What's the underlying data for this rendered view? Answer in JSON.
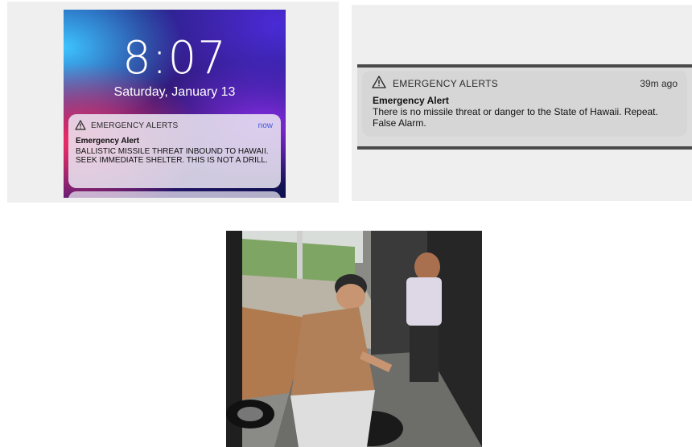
{
  "lockscreen": {
    "time": "8:07",
    "date": "Saturday, January 13",
    "notification": {
      "app": "EMERGENCY ALERTS",
      "time": "now",
      "title": "Emergency Alert",
      "body": "BALLISTIC MISSILE THREAT INBOUND TO HAWAII. SEEK IMMEDIATE SHELTER. THIS IS NOT A DRILL."
    }
  },
  "banner": {
    "app": "EMERGENCY ALERTS",
    "time": "39m ago",
    "title": "Emergency Alert",
    "body": "There is no missile threat or danger to the State of Hawaii. Repeat. False Alarm."
  },
  "icons": {
    "alert": "warning-triangle-icon"
  },
  "colors": {
    "notification_time": "#3a5ad6",
    "lock_notification_bg": "#e8e4f0",
    "banner_bg": "#d6d6d6"
  }
}
